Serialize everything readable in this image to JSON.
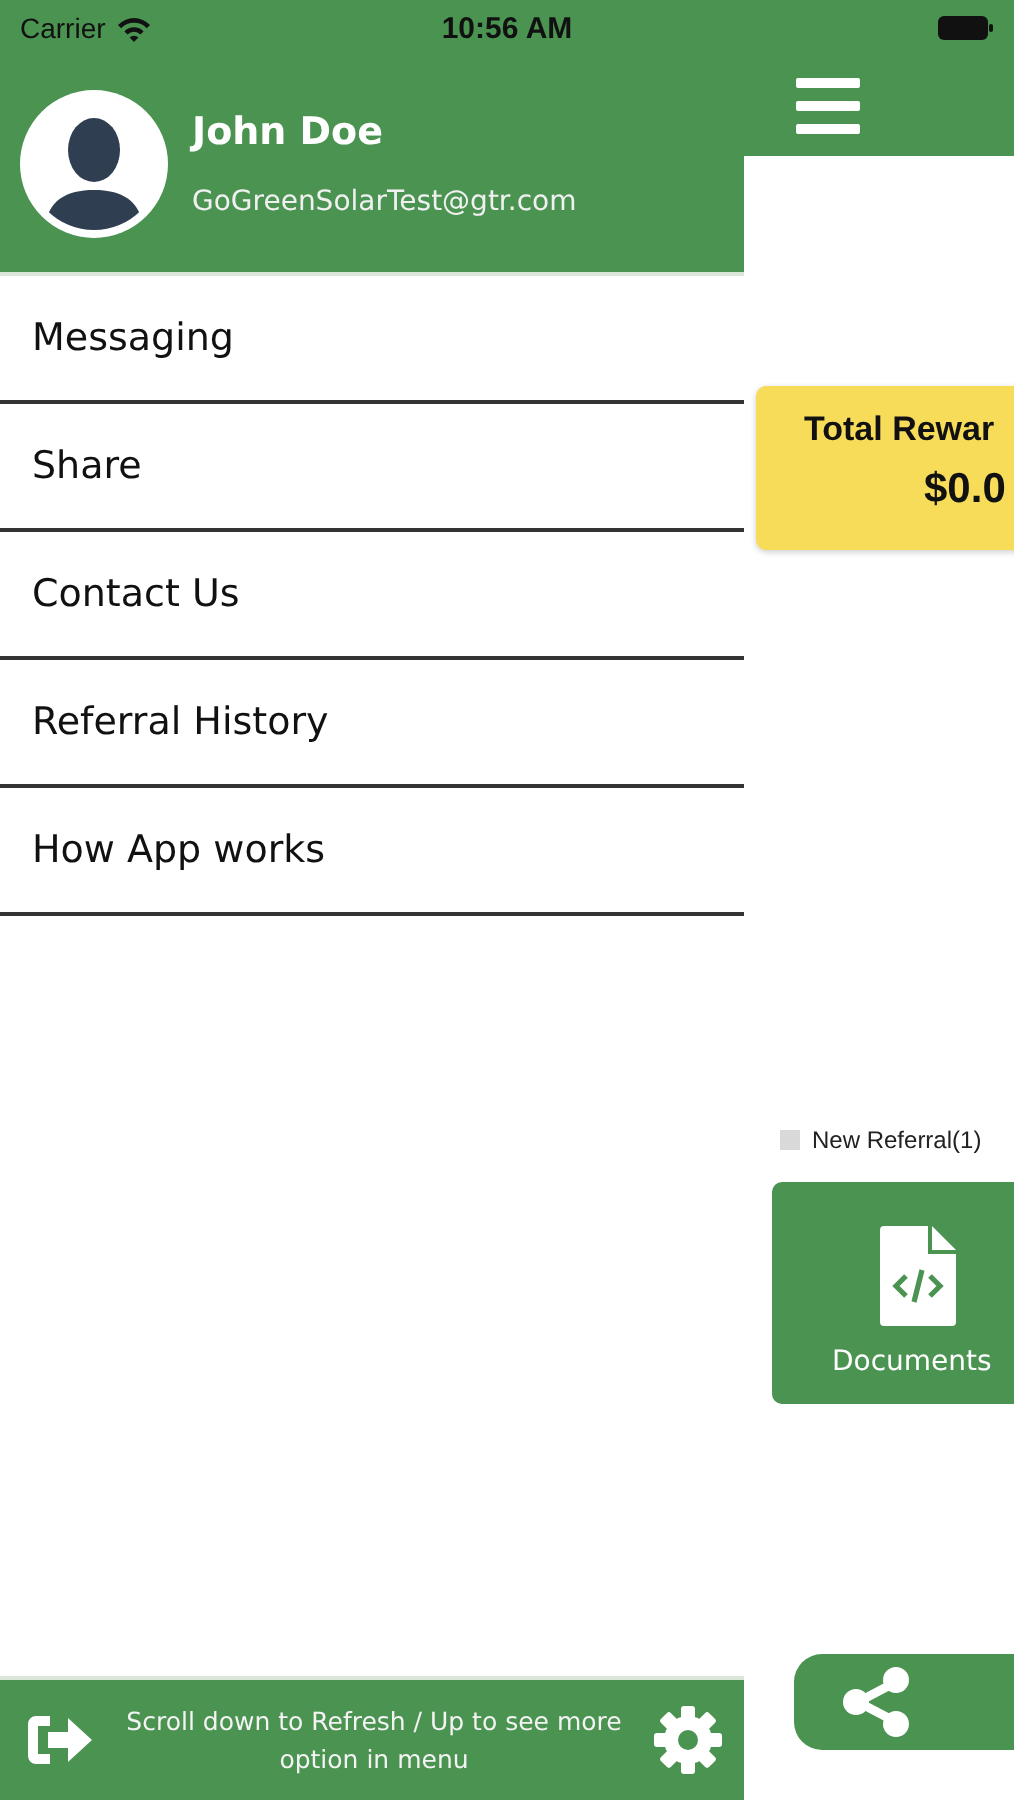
{
  "status_bar": {
    "carrier": "Carrier",
    "time": "10:56 AM"
  },
  "drawer": {
    "user": {
      "name": "John Doe",
      "email": "GoGreenSolarTest@gtr.com"
    },
    "items": [
      {
        "label": "Messaging"
      },
      {
        "label": "Share"
      },
      {
        "label": "Contact Us"
      },
      {
        "label": "Referral History"
      },
      {
        "label": "How App works"
      }
    ],
    "footer": {
      "hint": "Scroll down to Refresh / Up to see more option in menu"
    }
  },
  "main": {
    "rewards": {
      "title": "Total Rewar",
      "amount": "$0.0"
    },
    "legend": [
      {
        "label": "New Referral(1)",
        "color": "#d9d9d9"
      }
    ],
    "documents": {
      "label": "Documents"
    }
  }
}
